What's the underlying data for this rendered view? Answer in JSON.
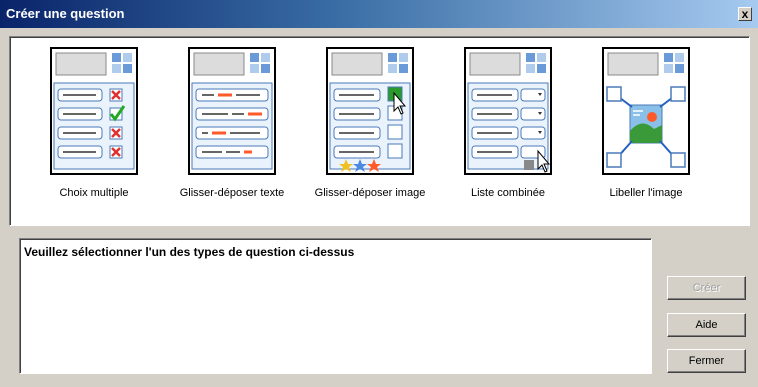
{
  "window": {
    "title": "Créer une question",
    "close_label": "x"
  },
  "question_types": [
    {
      "label": "Choix multiple",
      "icon": "multiple-choice-icon"
    },
    {
      "label": "Glisser-déposer texte",
      "icon": "drag-drop-text-icon"
    },
    {
      "label": "Glisser-déposer image",
      "icon": "drag-drop-image-icon"
    },
    {
      "label": "Liste combinée",
      "icon": "combo-list-icon"
    },
    {
      "label": "Libeller l'image",
      "icon": "label-image-icon"
    }
  ],
  "description": {
    "text": "Veuillez sélectionner l'un des types de question ci-dessus"
  },
  "buttons": {
    "create": "Créer",
    "help": "Aide",
    "close": "Fermer"
  },
  "colors": {
    "title_start": "#0a246a",
    "title_end": "#a6caf0",
    "accent_red": "#ff5a28",
    "check_green": "#22aa22"
  }
}
